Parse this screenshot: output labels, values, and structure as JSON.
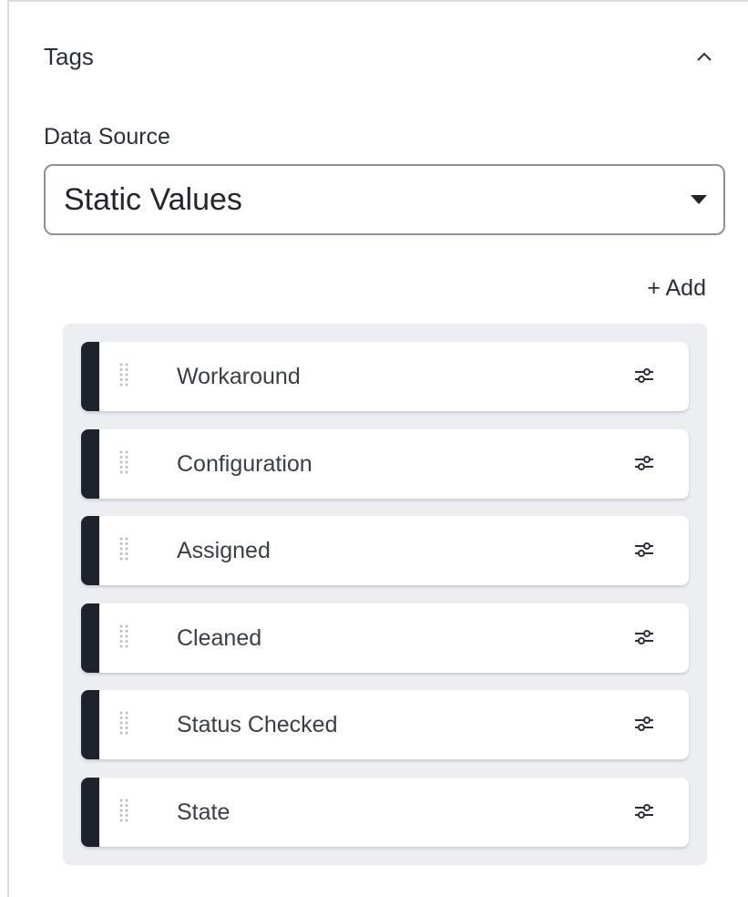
{
  "panel": {
    "title": "Tags",
    "collapse_icon": "chevron-up-icon"
  },
  "data_source": {
    "label": "Data Source",
    "selected": "Static Values",
    "dropdown_icon": "caret-down-icon"
  },
  "add_label": "+ Add",
  "tags": [
    {
      "label": "Workaround"
    },
    {
      "label": "Configuration"
    },
    {
      "label": "Assigned"
    },
    {
      "label": "Cleaned"
    },
    {
      "label": "Status Checked"
    },
    {
      "label": "State"
    }
  ],
  "icons": {
    "drag": "drag-handle-icon",
    "settings": "sliders-icon"
  },
  "colors": {
    "accent": "#1e222c",
    "list_background": "#eceef2",
    "border": "#8d919a"
  }
}
